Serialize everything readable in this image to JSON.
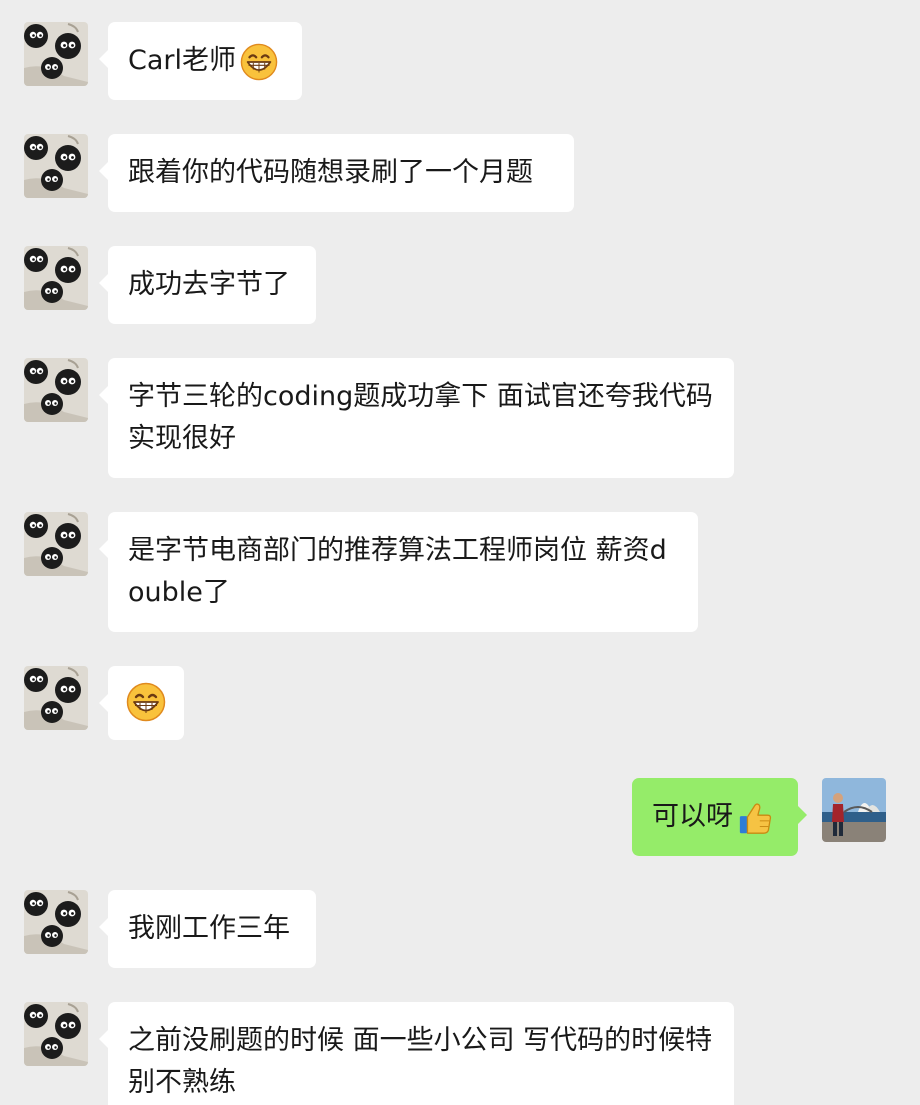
{
  "chat": {
    "messages": [
      {
        "sender": "other",
        "text": "Carl老师",
        "emoji": "grinning-face"
      },
      {
        "sender": "other",
        "text": "跟着你的代码随想录刷了一个月题"
      },
      {
        "sender": "other",
        "text": "成功去字节了"
      },
      {
        "sender": "other",
        "text": "字节三轮的coding题成功拿下 面试官还夸我代码实现很好"
      },
      {
        "sender": "other",
        "text": "是字节电商部门的推荐算法工程师岗位 薪资double了"
      },
      {
        "sender": "other",
        "text": "",
        "emoji": "grinning-face"
      },
      {
        "sender": "me",
        "text": "可以呀",
        "emoji": "thumbs-up"
      },
      {
        "sender": "other",
        "text": "我刚工作三年"
      },
      {
        "sender": "other",
        "text": "之前没刷题的时候 面一些小公司 写代码的时候特别不熟练"
      }
    ]
  },
  "colors": {
    "background": "#ededed",
    "incoming_bubble": "#ffffff",
    "outgoing_bubble": "#95ec69",
    "text": "#191919"
  }
}
